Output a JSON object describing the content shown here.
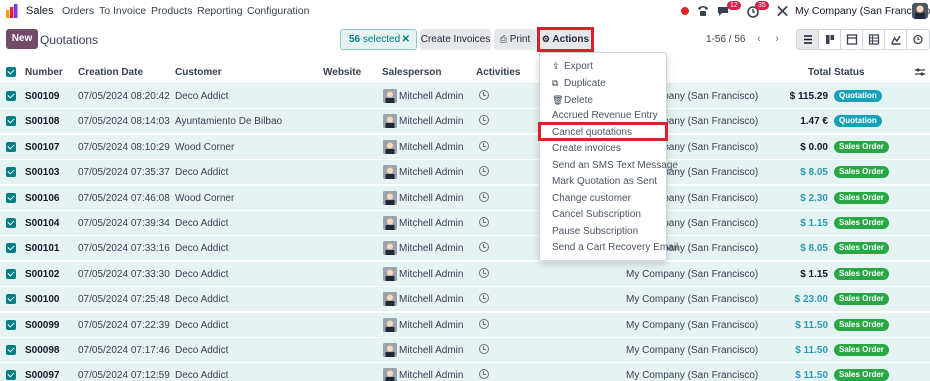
{
  "nav": {
    "app_name": "Sales",
    "menu": [
      "Orders",
      "To Invoice",
      "Products",
      "Reporting",
      "Configuration"
    ],
    "badges": {
      "chat": "12",
      "activity": "35"
    },
    "company": "My Company (San Francisco)"
  },
  "control": {
    "new_label": "New",
    "title": "Quotations",
    "selected_count": "56",
    "selected_suffix": "selected",
    "create_invoices_label": "Create Invoices",
    "print_label": "Print",
    "actions_label": "Actions",
    "pager": "1-56 / 56"
  },
  "columns": {
    "number": "Number",
    "creation_date": "Creation Date",
    "customer": "Customer",
    "website": "Website",
    "salesperson": "Salesperson",
    "activities": "Activities",
    "total": "Total",
    "status": "Status"
  },
  "rows": [
    {
      "number": "S00109",
      "date": "07/05/2024 08:20:42",
      "customer": "Deco Addict",
      "salesperson": "Mitchell Admin",
      "company": "My Company (San Francisco)",
      "total": "$ 115.29",
      "status": "Quotation"
    },
    {
      "number": "S00108",
      "date": "07/05/2024 08:14:03",
      "customer": "Ayuntamiento De Bilbao",
      "salesperson": "Mitchell Admin",
      "company": "My Company (San Francisco)",
      "total": "1.47 €",
      "status": "Quotation"
    },
    {
      "number": "S00107",
      "date": "07/05/2024 08:10:29",
      "customer": "Wood Corner",
      "salesperson": "Mitchell Admin",
      "company": "My Company (San Francisco)",
      "total": "$ 0.00",
      "status": "Sales Order"
    },
    {
      "number": "S00103",
      "date": "07/05/2024 07:35:37",
      "customer": "Deco Addict",
      "salesperson": "Mitchell Admin",
      "company": "My Company (San Francisco)",
      "total": "$ 8.05",
      "status": "Sales Order"
    },
    {
      "number": "S00106",
      "date": "07/05/2024 07:46:08",
      "customer": "Wood Corner",
      "salesperson": "Mitchell Admin",
      "company": "My Company (San Francisco)",
      "total": "$ 2.30",
      "status": "Sales Order"
    },
    {
      "number": "S00104",
      "date": "07/05/2024 07:39:34",
      "customer": "Deco Addict",
      "salesperson": "Mitchell Admin",
      "company": "My Company (San Francisco)",
      "total": "$ 1.15",
      "status": "Sales Order"
    },
    {
      "number": "S00101",
      "date": "07/05/2024 07:33:16",
      "customer": "Deco Addict",
      "salesperson": "Mitchell Admin",
      "company": "My Company (San Francisco)",
      "total": "$ 8.05",
      "status": "Sales Order"
    },
    {
      "number": "S00102",
      "date": "07/05/2024 07:33:30",
      "customer": "Deco Addict",
      "salesperson": "Mitchell Admin",
      "company": "My Company (San Francisco)",
      "total": "$ 1.15",
      "status": "Sales Order"
    },
    {
      "number": "S00100",
      "date": "07/05/2024 07:25:48",
      "customer": "Deco Addict",
      "salesperson": "Mitchell Admin",
      "company": "My Company (San Francisco)",
      "total": "$ 23.00",
      "status": "Sales Order"
    },
    {
      "number": "S00099",
      "date": "07/05/2024 07:22:39",
      "customer": "Deco Addict",
      "salesperson": "Mitchell Admin",
      "company": "My Company (San Francisco)",
      "total": "$ 11.50",
      "status": "Sales Order"
    },
    {
      "number": "S00098",
      "date": "07/05/2024 07:17:46",
      "customer": "Deco Addict",
      "salesperson": "Mitchell Admin",
      "company": "My Company (San Francisco)",
      "total": "$ 11.50",
      "status": "Sales Order"
    },
    {
      "number": "S00097",
      "date": "07/05/2024 07:12:59",
      "customer": "Deco Addict",
      "salesperson": "Mitchell Admin",
      "company": "My Company (San Francisco)",
      "total": "$ 11.50",
      "status": "Sales Order"
    }
  ],
  "total_colors": [
    "#111827",
    "#111827",
    "#111827",
    "#2b9bb5",
    "#2b9bb5",
    "#2b9bb5",
    "#2b9bb5",
    "#111827",
    "#2b9bb5",
    "#2b9bb5",
    "#2b9bb5",
    "#2b9bb5"
  ],
  "status_colors": {
    "Quotation": "#17a2b8",
    "Sales Order": "#28a745"
  },
  "actions_menu": [
    {
      "label": "Export",
      "icon": "export-icon"
    },
    {
      "label": "Duplicate",
      "icon": "duplicate-icon"
    },
    {
      "label": "Delete",
      "icon": "trash-icon"
    },
    {
      "label": "Accrued Revenue Entry",
      "icon": ""
    },
    {
      "label": "Cancel quotations",
      "icon": ""
    },
    {
      "label": "Create invoices",
      "icon": ""
    },
    {
      "label": "Send an SMS Text Message",
      "icon": ""
    },
    {
      "label": "Mark Quotation as Sent",
      "icon": ""
    },
    {
      "label": "Change customer",
      "icon": ""
    },
    {
      "label": "Cancel Subscription",
      "icon": ""
    },
    {
      "label": "Pause Subscription",
      "icon": ""
    },
    {
      "label": "Send a Cart Recovery Email",
      "icon": ""
    }
  ],
  "highlighted_item": "Cancel quotations"
}
